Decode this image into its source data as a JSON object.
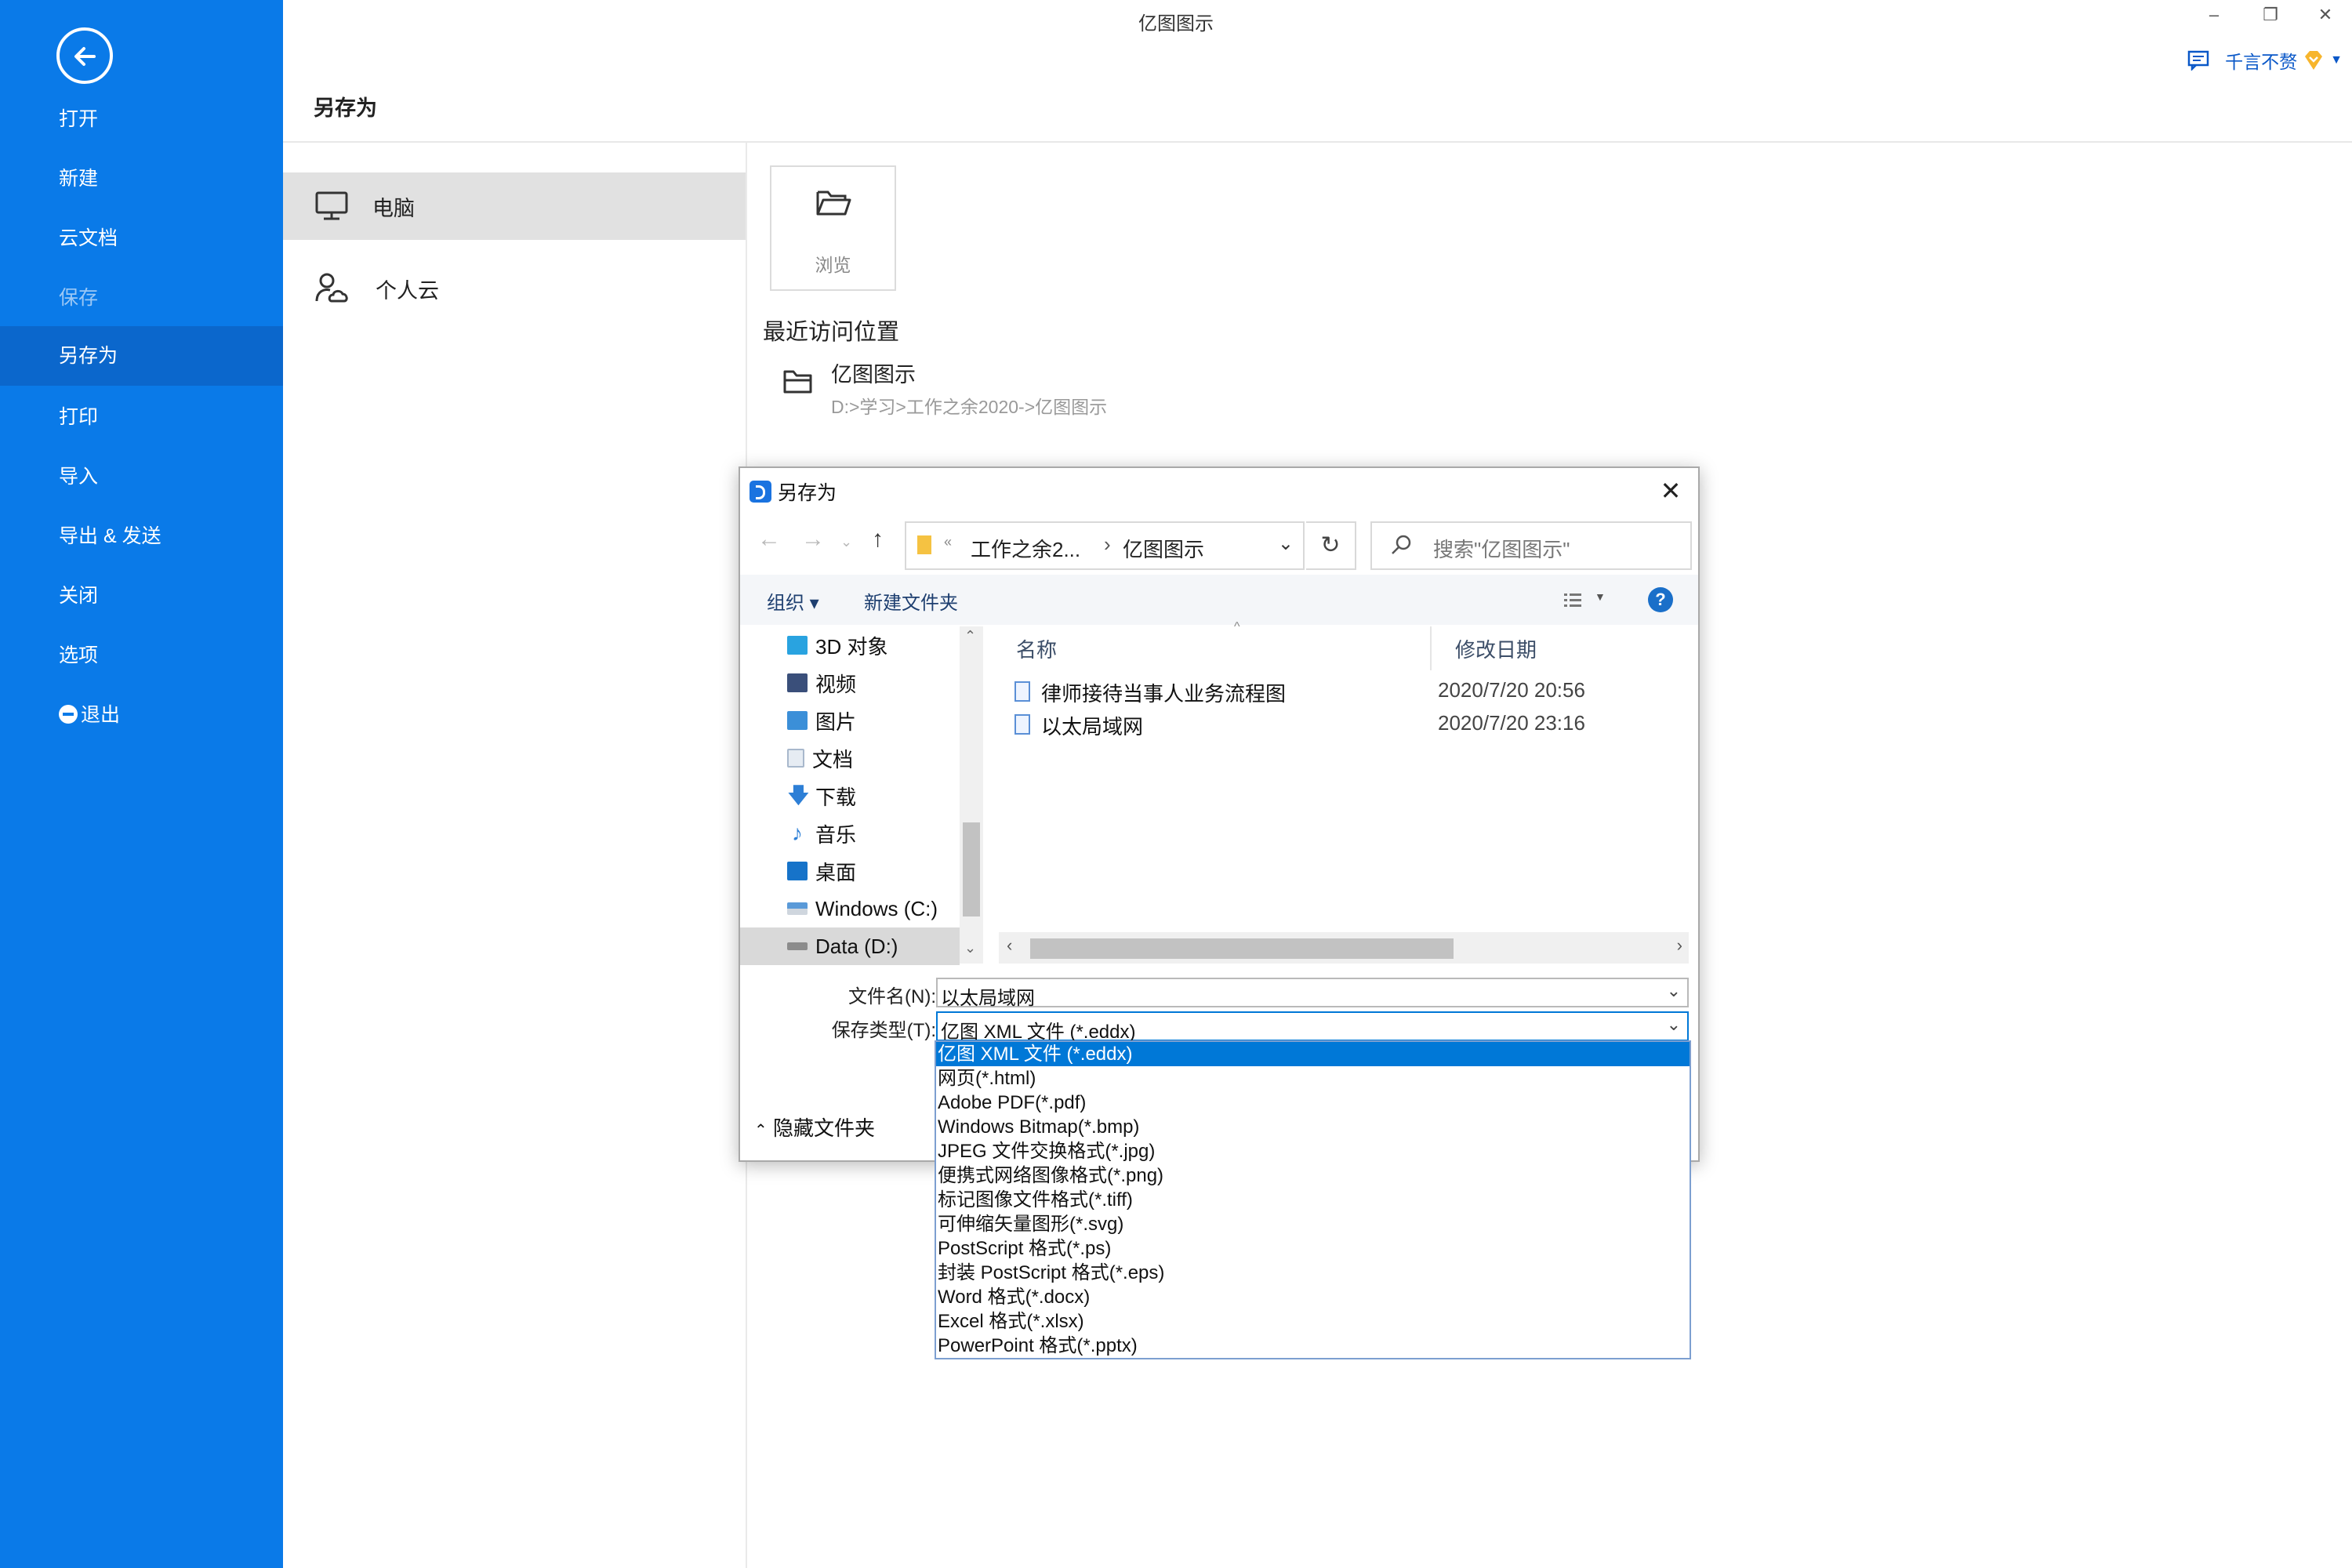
{
  "app_title": "亿图图示",
  "sidebar": {
    "items": [
      {
        "label": "打开",
        "state": "normal"
      },
      {
        "label": "新建",
        "state": "normal"
      },
      {
        "label": "云文档",
        "state": "normal"
      },
      {
        "label": "保存",
        "state": "disabled"
      },
      {
        "label": "另存为",
        "state": "active"
      },
      {
        "label": "打印",
        "state": "normal"
      },
      {
        "label": "导入",
        "state": "normal"
      },
      {
        "label": "导出 & 发送",
        "state": "normal"
      },
      {
        "label": "关闭",
        "state": "normal"
      },
      {
        "label": "选项",
        "state": "normal"
      },
      {
        "label": "退出",
        "state": "normal"
      }
    ]
  },
  "window_controls": {
    "minimize": "–",
    "restore": "❐",
    "close": "✕"
  },
  "user": {
    "name": "千言不赘"
  },
  "page_title": "另存为",
  "locations": [
    {
      "label": "电脑",
      "icon": "monitor-icon",
      "active": true
    },
    {
      "label": "个人云",
      "icon": "person-cloud-icon",
      "active": false
    }
  ],
  "browse": {
    "label": "浏览"
  },
  "recent": {
    "title": "最近访问位置",
    "items": [
      {
        "name": "亿图图示",
        "path": "D:>学习>工作之余2020->亿图图示"
      }
    ]
  },
  "dialog": {
    "title": "另存为",
    "close": "✕",
    "address": {
      "crumb1": "工作之余2...",
      "crumb2": "亿图图示",
      "prefix": "«"
    },
    "search_placeholder": "搜索\"亿图图示\"",
    "toolbar": {
      "organize": "组织 ▾",
      "new_folder": "新建文件夹",
      "help": "?"
    },
    "tree": [
      {
        "label": "3D 对象",
        "color": "#29a3e0"
      },
      {
        "label": "视频",
        "color": "#3a4f7a"
      },
      {
        "label": "图片",
        "color": "#3b8fd8"
      },
      {
        "label": "文档",
        "color": "#a8b8cc"
      },
      {
        "label": "下载",
        "color": "#2d7fd6"
      },
      {
        "label": "音乐",
        "color": "#2d7fd6"
      },
      {
        "label": "桌面",
        "color": "#1673c9"
      },
      {
        "label": "Windows (C:)",
        "color": "#5a9ad8"
      },
      {
        "label": "Data (D:)",
        "color": "#8c8c8c",
        "selected": true
      }
    ],
    "columns": {
      "name": "名称",
      "date": "修改日期"
    },
    "files": [
      {
        "name": "律师接待当事人业务流程图",
        "date": "2020/7/20 20:56"
      },
      {
        "name": "以太局域网",
        "date": "2020/7/20 23:16"
      }
    ],
    "filename_label": "文件名(N):",
    "filename_value": "以太局域网",
    "filetype_label": "保存类型(T):",
    "filetype_value": "亿图 XML 文件 (*.eddx)",
    "hide_folders": "隐藏文件夹"
  },
  "filetype_options": [
    "亿图 XML 文件 (*.eddx)",
    "网页(*.html)",
    "Adobe PDF(*.pdf)",
    "Windows Bitmap(*.bmp)",
    "JPEG 文件交换格式(*.jpg)",
    "便携式网络图像格式(*.png)",
    "标记图像文件格式(*.tiff)",
    "可伸缩矢量图形(*.svg)",
    "PostScript 格式(*.ps)",
    "封装 PostScript 格式(*.eps)",
    "Word 格式(*.docx)",
    "Excel 格式(*.xlsx)",
    "PowerPoint 格式(*.pptx)"
  ],
  "colors": {
    "sidebar": "#0a7ae8",
    "sidebar_active": "#0b67cc",
    "selection": "#0078d7",
    "user_link": "#0a58c8"
  }
}
